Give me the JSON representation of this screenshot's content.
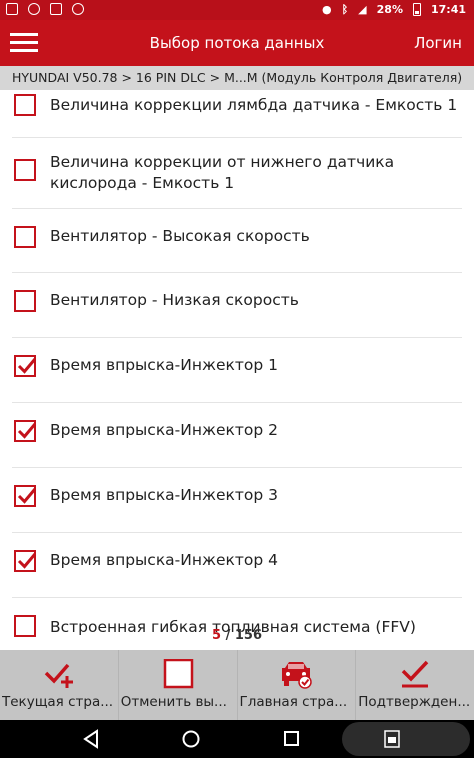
{
  "status": {
    "battery": "28%",
    "time": "17:41"
  },
  "header": {
    "title": "Выбор потока данных",
    "login_label": "Логин",
    "menu_icon": "hamburger-icon"
  },
  "breadcrumb": "HYUNDAI V50.78 > 16 PIN DLC > M...M (Модуль Контроля Двигателя)",
  "items": [
    {
      "label": "Величина коррекции лямбда датчика - Емкость 1",
      "checked": false
    },
    {
      "label": "Величина коррекции от нижнего датчика кислорода - Емкость 1",
      "checked": false
    },
    {
      "label": "Вентилятор - Высокая скорость",
      "checked": false
    },
    {
      "label": "Вентилятор - Низкая скорость",
      "checked": false
    },
    {
      "label": "Время впрыска-Инжектор 1",
      "checked": true
    },
    {
      "label": "Время впрыска-Инжектор 2",
      "checked": true
    },
    {
      "label": "Время впрыска-Инжектор 3",
      "checked": true
    },
    {
      "label": "Время впрыска-Инжектор 4",
      "checked": true
    },
    {
      "label": "Встроенная гибкая топливная система (FFV)",
      "checked": false
    }
  ],
  "counter": {
    "current": "5",
    "separator": " / ",
    "total": "156"
  },
  "toolbar": [
    {
      "label": "Текущая стра...",
      "icon": "check-plus-icon"
    },
    {
      "label": "Отменить вы...",
      "icon": "empty-checkbox-icon"
    },
    {
      "label": "Главная стра...",
      "icon": "car-check-icon"
    },
    {
      "label": "Подтвержден...",
      "icon": "confirm-check-icon"
    }
  ],
  "colors": {
    "accent": "#c4121b",
    "toolbar_bg": "#c4c4c4",
    "breadcrumb_bg": "#d6d6d6"
  }
}
